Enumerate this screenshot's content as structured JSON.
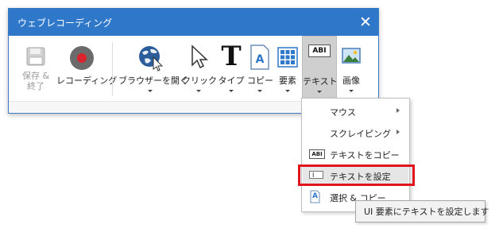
{
  "window": {
    "title": "ウェブレコーディング",
    "close_glyph": "✕",
    "accent": "#2f77c9"
  },
  "toolbar": {
    "save_end": {
      "line1": "保存 &",
      "line2": "終了",
      "icon": "floppy-disk-icon",
      "enabled": false
    },
    "record": {
      "label": "レコーディング",
      "icon": "record-icon"
    },
    "open_browser": {
      "label": "ブラウザーを開く",
      "icon": "globe-cursor-icon"
    },
    "click": {
      "label": "クリック",
      "icon": "mouse-pointer-icon"
    },
    "type": {
      "label": "タイプ",
      "icon": "type-t-icon",
      "glyph": "T"
    },
    "copy": {
      "label": "コピー",
      "icon": "document-a-icon",
      "glyph": "A"
    },
    "elements": {
      "label": "要素",
      "icon": "grid-elements-icon"
    },
    "text": {
      "label": "テキスト",
      "icon": "abi-text-icon",
      "glyph": "ABI",
      "active": true
    },
    "image": {
      "label": "画像",
      "icon": "picture-icon"
    }
  },
  "menu": {
    "items": [
      {
        "label": "マウス",
        "has_submenu": true
      },
      {
        "label": "スクレイピング",
        "has_submenu": true
      },
      {
        "label": "テキストをコピー",
        "icon": "abi-text-icon",
        "glyph": "ABI"
      },
      {
        "label": "テキストを設定",
        "icon": "text-field-icon",
        "glyph": "I",
        "highlighted": true
      },
      {
        "label": "選択 & コピー",
        "icon": "document-a-icon",
        "glyph": "A"
      }
    ]
  },
  "tooltip": {
    "text": "UI 要素にテキストを設定します"
  },
  "colors": {
    "highlight_border": "#e0141c",
    "record_red": "#d9232e",
    "record_gray": "#6b6b6b"
  }
}
